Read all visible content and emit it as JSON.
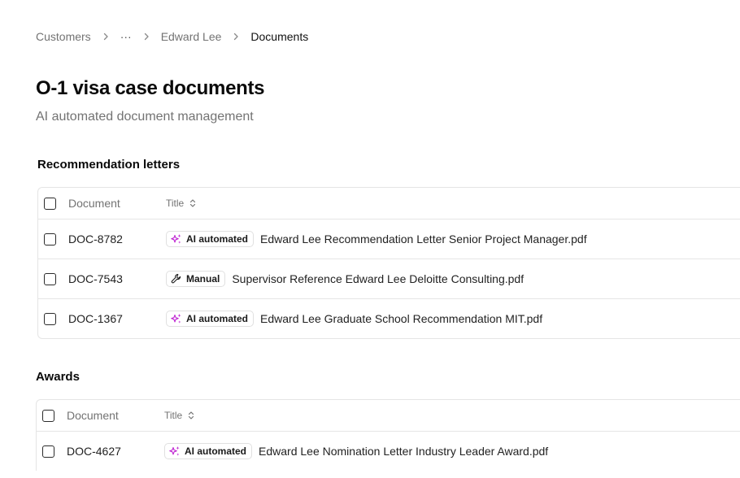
{
  "breadcrumb": {
    "items": [
      "Customers",
      "···",
      "Edward Lee",
      "Documents"
    ]
  },
  "page": {
    "title": "O-1 visa case documents",
    "subtitle": "AI automated document management"
  },
  "sections": [
    {
      "title": "Recommendation letters",
      "columns": {
        "document": "Document",
        "title": "Title"
      },
      "rows": [
        {
          "doc_id": "DOC-8782",
          "badge": "AI automated",
          "badge_icon": "sparkles-icon",
          "file": "Edward Lee Recommendation Letter Senior Project Manager.pdf"
        },
        {
          "doc_id": "DOC-7543",
          "badge": "Manual",
          "badge_icon": "wrench-icon",
          "file": "Supervisor Reference Edward Lee Deloitte Consulting.pdf"
        },
        {
          "doc_id": "DOC-1367",
          "badge": "AI automated",
          "badge_icon": "sparkles-icon",
          "file": "Edward Lee Graduate School Recommendation MIT.pdf"
        }
      ]
    },
    {
      "title": "Awards",
      "columns": {
        "document": "Document",
        "title": "Title"
      },
      "rows": [
        {
          "doc_id": "DOC-4627",
          "badge": "AI automated",
          "badge_icon": "sparkles-icon",
          "file": "Edward Lee Nomination Letter Industry Leader Award.pdf"
        }
      ]
    }
  ],
  "colors": {
    "ai_badge_icon": "#c026d3",
    "muted_text": "#737373",
    "border": "#e5e5e5"
  }
}
